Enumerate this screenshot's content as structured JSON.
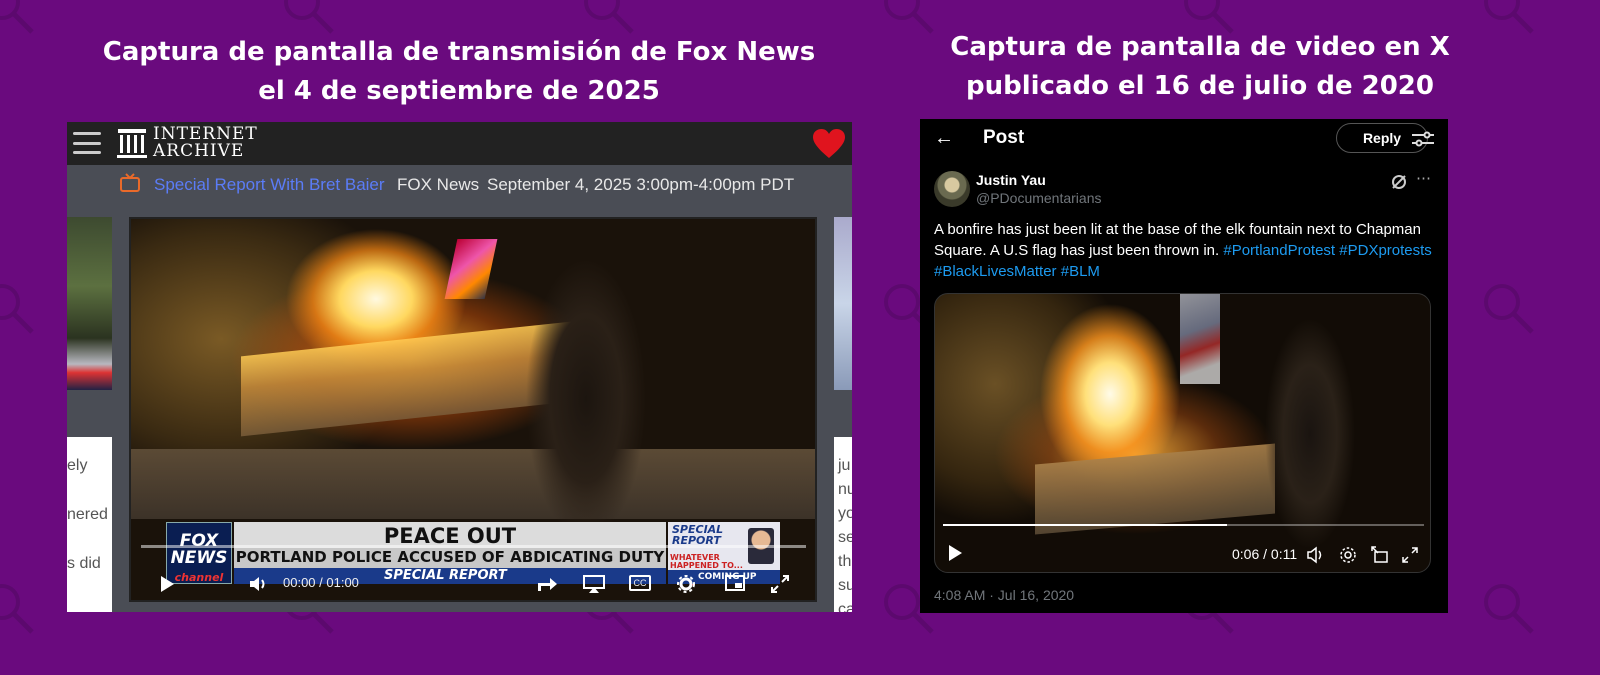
{
  "captions": {
    "left": "Captura de pantalla de transmisión de Fox News\nel 4 de septiembre de 2025",
    "right": "Captura de pantalla de video en X\npublicado el 16 de julio de 2020"
  },
  "internet_archive": {
    "logo_line1": "INTERNET",
    "logo_line2": "ARCHIVE",
    "show_title": "Special Report With Bret Baier",
    "network": "FOX News",
    "air_date": "September 4, 2025 3:00pm-4:00pm PDT",
    "side_text_left": [
      "ely",
      "nered",
      "s did"
    ],
    "side_text_right": [
      "ju",
      "nu",
      "yo",
      "se",
      "th",
      "su",
      "ca"
    ],
    "lower_third": {
      "logo_line1": "FOX",
      "logo_line2": "NEWS",
      "logo_line3": "channel",
      "headline": "PEACE OUT",
      "subheadline": "PORTLAND POLICE ACCUSED OF ABDICATING DUTY",
      "show_bar": "SPECIAL REPORT",
      "side_title_1": "SPECIAL",
      "side_title_2": "REPORT",
      "side_teaser": "WHATEVER HAPPENED TO... NEW AIR FORCE ONE JET",
      "coming_up": "COMING UP"
    },
    "player": {
      "time": "00:00  /  01:00",
      "progress": 0,
      "cc_label": "CC"
    }
  },
  "x_post": {
    "header_title": "Post",
    "reply_label": "Reply",
    "author_name": "Justin Yau",
    "author_handle": "@PDocumentarians",
    "text_plain": "A bonfire has just been lit at the base of the elk fountain next to Chapman Square. A U.S flag has just been thrown in.",
    "hashtags": [
      "#PortlandProtest",
      "#PDXprotests",
      "#BlackLivesMatter",
      "#BLM"
    ],
    "video_time": "0:06 / 0:11",
    "video_progress": 0.59,
    "timestamp": "4:08 AM · Jul 16, 2020"
  },
  "colors": {
    "background": "#6a0a7e",
    "link_blue": "#1d9bf0",
    "ia_link": "#5b7cf7",
    "heart_red": "#e0141e"
  }
}
